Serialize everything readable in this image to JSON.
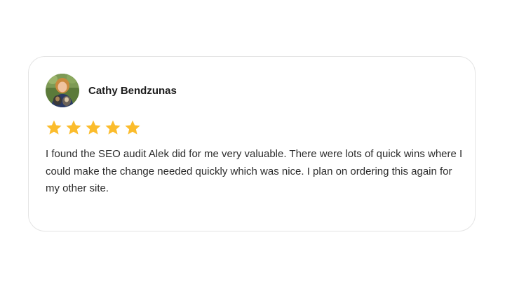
{
  "review": {
    "reviewer_name": "Cathy Bendzunas",
    "rating": 5,
    "rating_max": 5,
    "star_color": "#fbbc2c",
    "text": "I found the SEO audit Alek did for me very valuable. There were lots of quick wins where I could make the change needed quickly which was nice. I plan on ordering this again for my other site."
  }
}
